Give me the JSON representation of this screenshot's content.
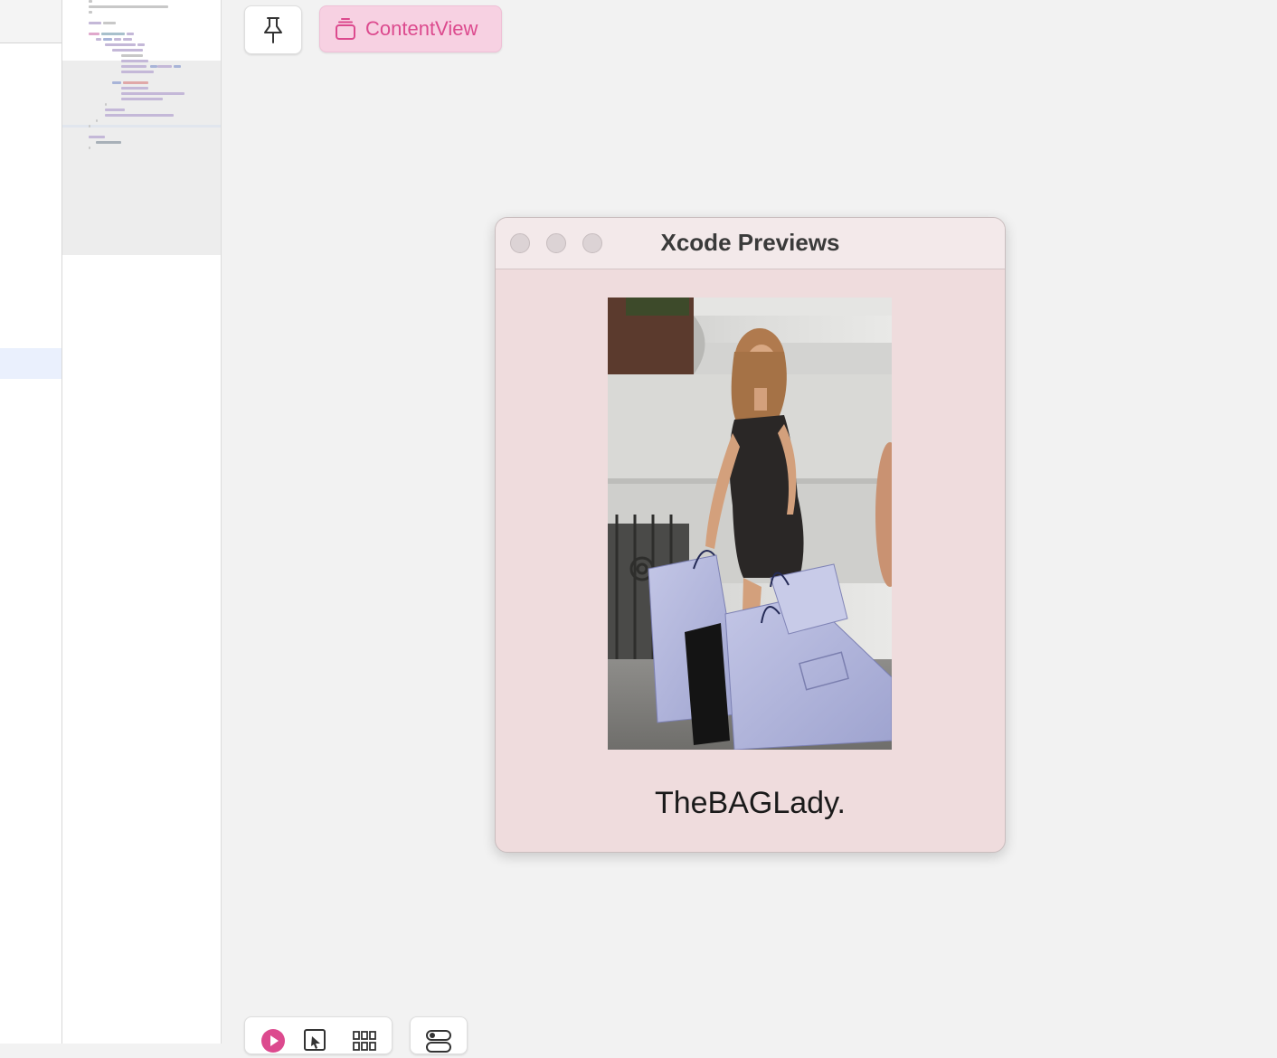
{
  "toolbar": {
    "pin_icon": "pin-icon",
    "view_selector_label": "ContentView",
    "view_selector_icon": "stack-icon"
  },
  "preview_window": {
    "title": "Xcode Previews",
    "traffic_lights": [
      "close",
      "minimize",
      "zoom"
    ],
    "image_description": "photo",
    "caption": "TheBAGLady."
  },
  "bottom_controls": {
    "icons": [
      "live-preview-icon",
      "selectable-icon",
      "variants-grid-icon",
      "device-settings-icon"
    ]
  },
  "colors": {
    "accent": "#dc4a8e",
    "window_bg": "#efdcdd",
    "canvas_bg": "#f2f2f2"
  }
}
